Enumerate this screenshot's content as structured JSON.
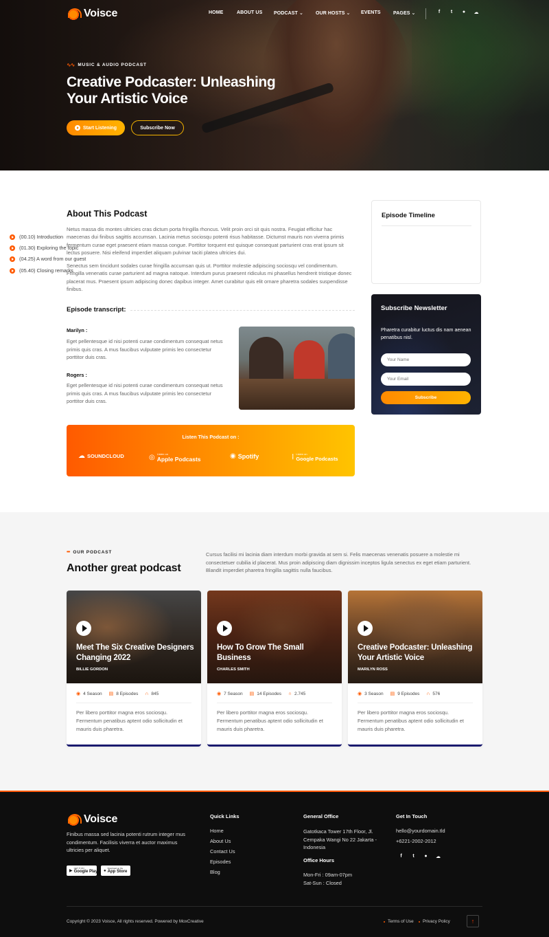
{
  "brand": {
    "name": "Voisce",
    "accent": "#ff5a00",
    "accent2": "#ffb300"
  },
  "nav": {
    "items": [
      {
        "label": "HOME"
      },
      {
        "label": "ABOUT US"
      },
      {
        "label": "PODCAST"
      },
      {
        "label": "OUR HOSTS"
      },
      {
        "label": "EVENTS"
      },
      {
        "label": "PAGES"
      }
    ],
    "social": [
      "f",
      "t",
      "●",
      "☁"
    ]
  },
  "hero": {
    "tag": "MUSIC & AUDIO PODCAST",
    "title": "Creative Podcaster: Unleashing Your Artistic Voice",
    "btn_listen": "Start Listening",
    "btn_subscribe": "Subscribe Now"
  },
  "about": {
    "title": "About This Podcast",
    "p1": "Netus massa dis montes ultricies cras dictum porta fringilla rhoncus. Velit proin orci sit quis nostra. Feugiat efficitur hac maecenas dui finibus sagittis accumsan. Lacinia metus sociosqu potenti risus habitasse. Dictumst mauris non viverra primis fermentum curae eget praesent etiam massa congue. Porttitor torquent est quisque consequat parturient cras erat ipsum sit lectus posuere. Nisi eleifend imperdiet aliquam pulvinar taciti platea ultricies dui.",
    "p2": "Senectus sem tincidunt sodales curae fringilla accumsan quis ut. Porttitor molestie adipiscing sociosqu vel condimentum. Fringilla venenatis curae parturient ad magna natoque. Interdum purus praesent ridiculus mi phasellus hendrerit tristique donec placerat mus. Praesent ipsum adipiscing donec dapibus integer. Amet curabitur quis elit ornare pharetra sodales suspendisse finibus.",
    "transcript_title": "Episode transcript:",
    "speakers": [
      {
        "name": "Marilyn :",
        "text": "Eget pellentesque id nisi potenti curae condimentum consequat netus primis quis cras. A mus faucibus vulputate primis leo consectetur porttitor duis cras."
      },
      {
        "name": "Rogers :",
        "text": "Eget pellentesque id nisi potenti curae condimentum consequat netus primis quis cras. A mus faucibus vulputate primis leo consectetur porttitor duis cras."
      }
    ],
    "listen_title": "Listen This Podcast on :",
    "platforms": {
      "soundcloud": "SOUNDCLOUD",
      "apple_small": "Listen on",
      "apple": "Apple Podcasts",
      "spotify": "Spotify",
      "google_small": "Listen on",
      "google": "Google Podcasts"
    }
  },
  "timeline": {
    "title": "Episode Timeline",
    "items": [
      "(00.10) Introduction",
      "(01.30) Exploring the topic",
      "(04.25) A word from our guest",
      "(05.40) Closing remarks"
    ]
  },
  "newsletter": {
    "title": "Subscribe Newsletter",
    "text": "Pharetra curabitur luctus dis nam aenean penatibus nisl.",
    "name_placeholder": "Your Name",
    "email_placeholder": "Your Email",
    "button": "Subscribe"
  },
  "podcasts": {
    "tag": "OUR PODCAST",
    "title": "Another great podcast",
    "description": "Cursus facilisi mi lacinia diam interdum morbi gravida at sem si. Felis maecenas venenatis posuere a molestie mi consectetuer cubilia id placerat. Mus proin adipiscing diam dignissim inceptos ligula senectus ex eget etiam parturient. Blandit imperdiet pharetra fringilla sagittis nulla faucibus.",
    "cards": [
      {
        "title": "Meet The Six Creative Designers Changing 2022",
        "author": "BILLIE GORDON",
        "season": "4 Season",
        "episodes": "8 Episodes",
        "listens": "845",
        "text": "Per libero porttitor magna eros sociosqu. Fermentum penatibus aptent odio sollicitudin et mauris duis pharetra."
      },
      {
        "title": "How To Grow The Small Business",
        "author": "CHARLES SMITH",
        "season": "7 Season",
        "episodes": "14 Episodes",
        "listens": "2.745",
        "text": "Per libero porttitor magna eros sociosqu. Fermentum penatibus aptent odio sollicitudin et mauris duis pharetra."
      },
      {
        "title": "Creative Podcaster: Unleashing Your Artistic Voice",
        "author": "MARILYN ROSS",
        "season": "3 Season",
        "episodes": "9 Episodes",
        "listens": "576",
        "text": "Per libero porttitor magna eros sociosqu. Fermentum penatibus aptent odio sollicitudin et mauris duis pharetra."
      }
    ]
  },
  "footer": {
    "about": "Finibus massa sed lacinia potenti rutrum integer mus condimentum. Facilisis viverra et auctor maximus ultricies per aliquet.",
    "google_play_small": "GET IT ON",
    "google_play": "Google Play",
    "app_store_small": "Download on the",
    "app_store": "App Store",
    "quick_links_title": "Quick Links",
    "quick_links": [
      "Home",
      "About Us",
      "Contact Us",
      "Episodes",
      "Blog"
    ],
    "office_title": "General Office",
    "office_address": "Gatotkaca Tower 17th Floor, Jl. Cempaka Wangi No 22 Jakarta - Indonesia",
    "hours_title": "Office Hours",
    "hours": [
      "Mon-Fri : 09am-07pm",
      "Sat-Sun : Closed"
    ],
    "contact_title": "Get In Touch",
    "email": "hello@yourdomain.tld",
    "phone": "+6221-2002-2012",
    "copyright": "Copyright © 2023 Voisce, All rights reserved. Powered by MoxCreative",
    "terms": "Terms of Use",
    "privacy": "Privacy Policy"
  }
}
